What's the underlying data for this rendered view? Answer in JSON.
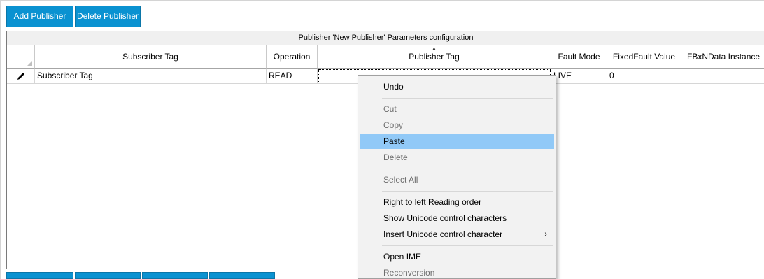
{
  "toolbar": {
    "add_label": "Add Publisher",
    "delete_label": "Delete Publisher"
  },
  "grid": {
    "caption": "Publisher 'New Publisher' Parameters configuration",
    "columns": [
      "Subscriber Tag",
      "Operation",
      "Publisher Tag",
      "Fault Mode",
      "FixedFault Value",
      "FBxNData Instance"
    ],
    "rows": [
      {
        "row_header_icon": "pencil-icon",
        "cells": [
          "Subscriber Tag",
          "READ",
          "",
          "LIVE",
          "0",
          ""
        ]
      }
    ]
  },
  "context_menu": {
    "items": [
      {
        "label": "Undo",
        "enabled": true
      },
      {
        "label": "Cut",
        "enabled": false
      },
      {
        "label": "Copy",
        "enabled": false
      },
      {
        "label": "Paste",
        "enabled": true,
        "highlighted": true
      },
      {
        "label": "Delete",
        "enabled": false
      },
      {
        "label": "Select All",
        "enabled": false
      },
      {
        "label": "Right to left Reading order",
        "enabled": true
      },
      {
        "label": "Show Unicode control characters",
        "enabled": true
      },
      {
        "label": "Insert Unicode control character",
        "enabled": true,
        "submenu": true,
        "submenu_glyph": "›"
      },
      {
        "label": "Open IME",
        "enabled": true
      },
      {
        "label": "Reconversion",
        "enabled": false
      }
    ]
  },
  "colors": {
    "button_blue": "#0a92d1",
    "menu_highlight": "#91c9f7"
  }
}
